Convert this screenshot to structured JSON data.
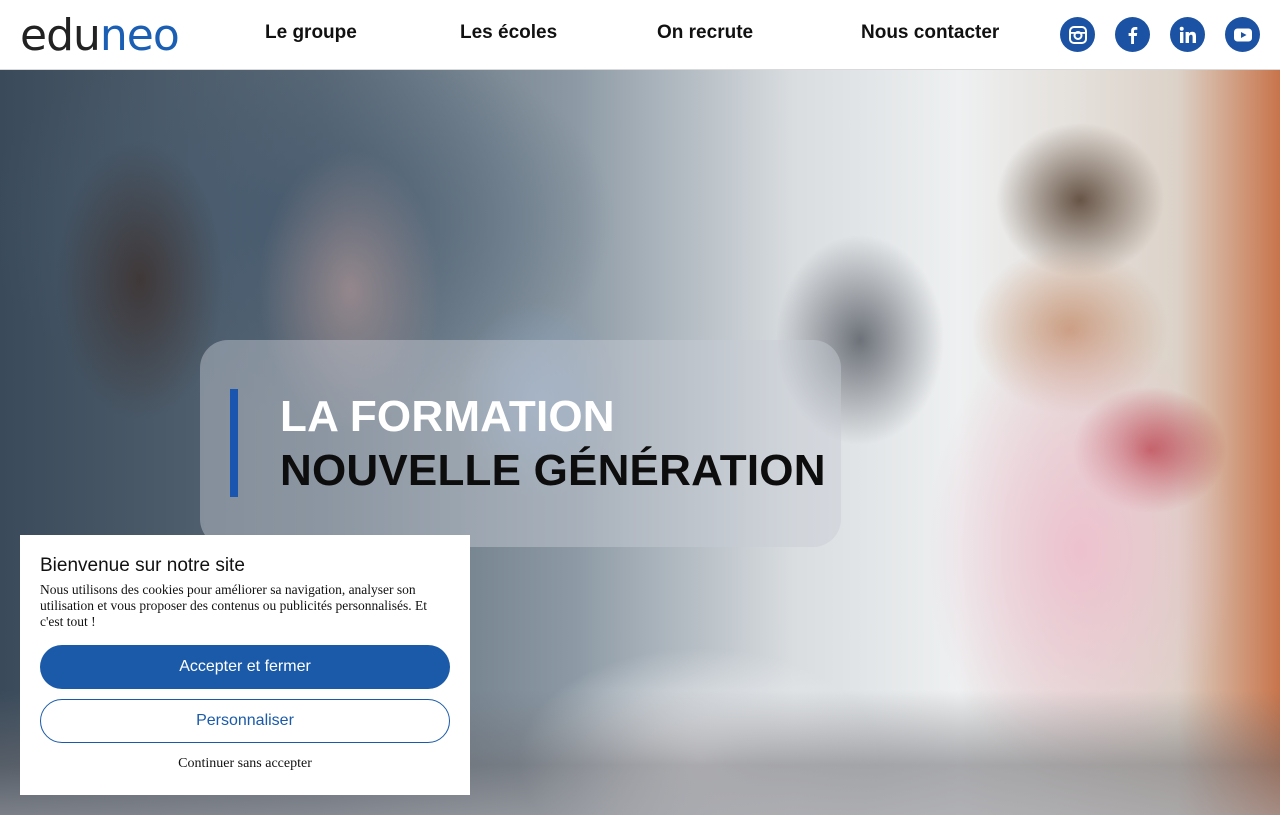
{
  "header": {
    "logo": {
      "part1": "edu",
      "part2": "neo"
    },
    "nav": [
      {
        "label": "Le groupe"
      },
      {
        "label": "Les écoles"
      },
      {
        "label": "On recrute"
      },
      {
        "label": "Nous contacter"
      }
    ],
    "social": [
      {
        "icon": "instagram-icon"
      },
      {
        "icon": "facebook-icon"
      },
      {
        "icon": "linkedin-icon"
      },
      {
        "icon": "youtube-icon"
      }
    ]
  },
  "hero": {
    "title_line1": "LA FORMATION",
    "title_line2": "NOUVELLE GÉNÉRATION"
  },
  "cookie": {
    "title": "Bienvenue sur notre site",
    "text": "Nous utilisons des cookies pour améliorer sa navigation, analyser son utilisation et vous proposer des contenus ou publicités personnalisés. Et c'est tout !",
    "accept_label": "Accepter et fermer",
    "customize_label": "Personnaliser",
    "continue_label": "Continuer sans accepter"
  },
  "colors": {
    "brand_blue": "#1a5aa8",
    "social_blue": "#1b52a3"
  }
}
